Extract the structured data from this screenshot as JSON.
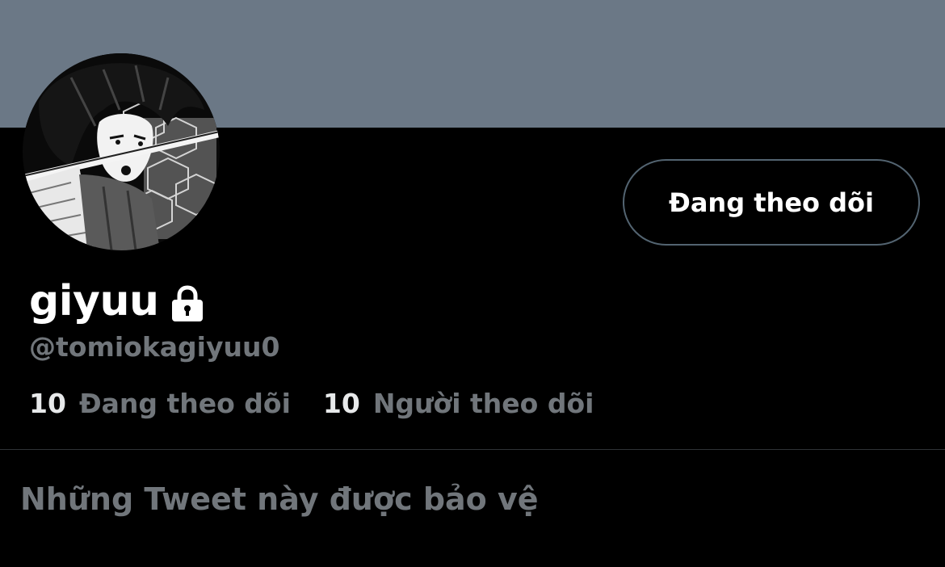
{
  "profile": {
    "display_name": "giyuu",
    "handle": "@tomiokagiyuu0",
    "lock_icon": "lock-icon",
    "banner_color": "#6b7886"
  },
  "follow_button": {
    "label": "Đang theo dõi"
  },
  "stats": [
    {
      "count": "10",
      "label": "Đang theo dõi"
    },
    {
      "count": "10",
      "label": "Người theo dõi"
    }
  ],
  "protected_message": "Những Tweet này được bảo vệ",
  "colors": {
    "background": "#000000",
    "primary_text": "#ffffff",
    "secondary_text": "#71767b",
    "button_border": "#536471",
    "divider": "#2f3336"
  }
}
